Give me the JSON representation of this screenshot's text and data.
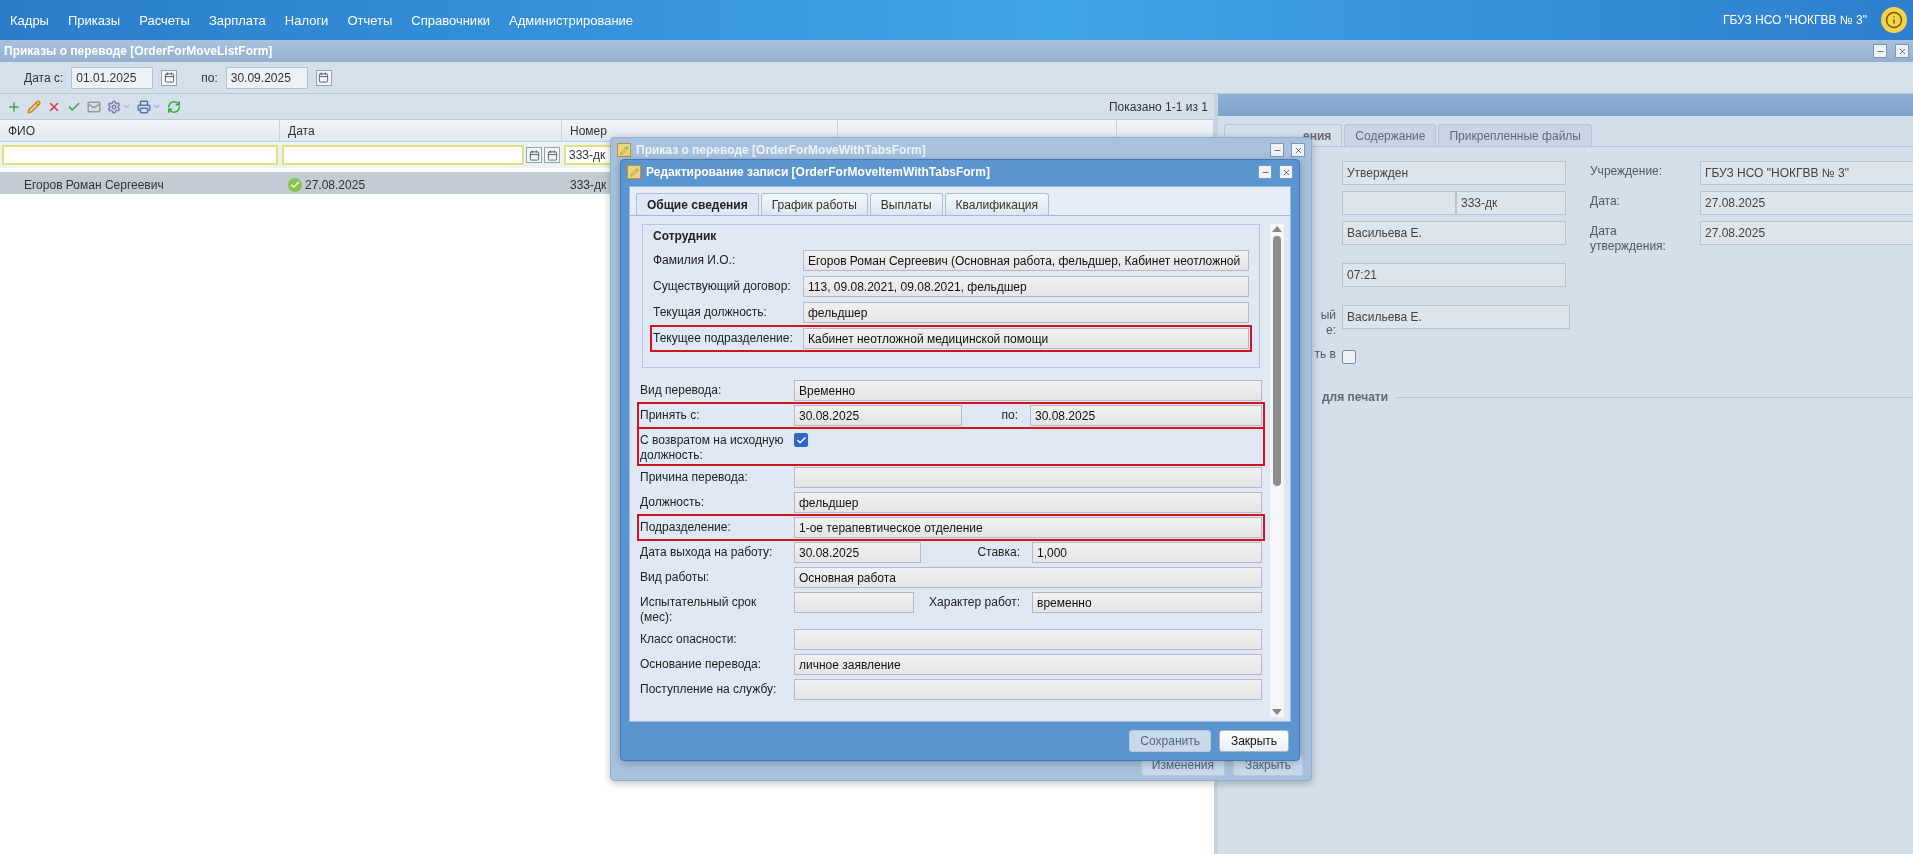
{
  "menu": [
    "Кадры",
    "Приказы",
    "Расчеты",
    "Зарплата",
    "Налоги",
    "Отчеты",
    "Справочники",
    "Администрирование"
  ],
  "organization": "ГБУЗ НСО \"НОКГВВ № 3\"",
  "list_window": {
    "title": "Приказы о переводе [OrderForMoveListForm]",
    "filter": {
      "from_label": "Дата с:",
      "from": "01.01.2025",
      "to_label": "по:",
      "to": "30.09.2025"
    },
    "paging": "Показано 1-1 из 1",
    "columns": [
      "ФИО",
      "Дата",
      "Номер"
    ],
    "number_filter": "333-дк",
    "rows": [
      {
        "fio": "Егоров Роман Сергеевич",
        "date": "27.08.2025",
        "number": "333-дк",
        "approved": true,
        "selected": true
      }
    ]
  },
  "details_panel": {
    "tabs": [
      {
        "label": "ения",
        "selected": true
      },
      {
        "label": "Содержание",
        "selected": false
      },
      {
        "label": "Прикрепленные файлы",
        "selected": false
      }
    ],
    "left_fields": [
      {
        "kind": "text",
        "value": "Утвержден"
      },
      {
        "kind": "pair",
        "value": "333-дк"
      },
      {
        "kind": "text",
        "value": "Васильева Е."
      },
      {
        "kind": "text",
        "value": "07:21"
      },
      {
        "kind": "text",
        "label_lines": [
          "ый",
          "е:"
        ],
        "value": "Васильева Е."
      },
      {
        "kind": "checkbox",
        "label_lines": [
          "ть в"
        ],
        "checked": false
      }
    ],
    "right_fields": [
      {
        "label": "Учреждение:",
        "value": "ГБУЗ НСО \"НОКГВВ № 3\""
      },
      {
        "label": "Дата:",
        "value": "27.08.2025"
      },
      {
        "label": "Дата утверждения:",
        "value": "27.08.2025"
      }
    ],
    "section": "для печати"
  },
  "move_dialog": {
    "title": "Приказ о переводе [OrderForMoveWithTabsForm]",
    "buttons": [
      "Изменения",
      "Закрыть"
    ]
  },
  "edit_dialog": {
    "title": "Редактирование записи [OrderForMoveItemWithTabsForm]",
    "tabs": [
      {
        "label": "Общие сведения",
        "selected": true
      },
      {
        "label": "График работы",
        "selected": false
      },
      {
        "label": "Выплаты",
        "selected": false
      },
      {
        "label": "Квалификация",
        "selected": false
      }
    ],
    "fieldset": {
      "legend": "Сотрудник",
      "rows": [
        {
          "label": "Фамилия И.О.:",
          "value": "Егоров Роман Сергеевич (Основная работа, фельдшер, Кабинет неотложной",
          "highlighted": false
        },
        {
          "label": "Существующий договор:",
          "value": "113, 09.08.2021, 09.08.2021, фельдшер",
          "highlighted": false
        },
        {
          "label": "Текущая должность:",
          "value": "фельдшер",
          "highlighted": false
        },
        {
          "label": "Текущее подразделение:",
          "value": "Кабинет неотложной медицинской помощи",
          "highlighted": true
        }
      ]
    },
    "rows": [
      {
        "kind": "text",
        "label": "Вид перевода:",
        "value": "Временно",
        "highlighted": false
      },
      {
        "kind": "range",
        "label": "Принять с:",
        "value": "30.08.2025",
        "to_label": "по:",
        "to_value": "30.08.2025",
        "highlighted": true
      },
      {
        "kind": "checkbox",
        "label": "С возвратом на исходную должность:",
        "checked": true,
        "highlighted": true
      },
      {
        "kind": "text",
        "label": "Причина перевода:",
        "highlighted": false
      },
      {
        "kind": "text",
        "label": "Должность:",
        "value": "фельдшер",
        "highlighted": false
      },
      {
        "kind": "text",
        "label": "Подразделение:",
        "value": "1-ое терапевтическое отделение",
        "highlighted": true
      },
      {
        "kind": "split",
        "label": "Дата выхода на работу:",
        "value": "30.08.2025",
        "label2": "Ставка:",
        "value2": "1,000",
        "highlighted": false
      },
      {
        "kind": "text",
        "label": "Вид работы:",
        "value": "Основная работа",
        "highlighted": false
      },
      {
        "kind": "split",
        "label": "Испытательный срок (мес):",
        "label2": "Характер работ:",
        "value2": "временно",
        "highlighted": false
      },
      {
        "kind": "text",
        "label": "Класс опасности:",
        "highlighted": false
      },
      {
        "kind": "text",
        "label": "Основание перевода:",
        "value": "личное заявление",
        "highlighted": false
      },
      {
        "kind": "text",
        "label": "Поступление на службу:",
        "highlighted": false
      }
    ],
    "buttons": [
      {
        "label": "Сохранить",
        "disabled": true
      },
      {
        "label": "Закрыть",
        "disabled": false
      }
    ]
  }
}
